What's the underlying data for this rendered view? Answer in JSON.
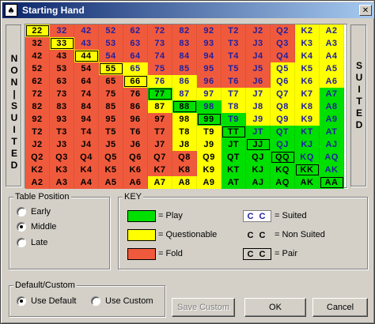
{
  "window": {
    "title": "Starting Hand",
    "icon": "playing-card-icon",
    "close_label": "✕"
  },
  "side_labels": {
    "left": [
      "N",
      "O",
      "N",
      "|",
      "S",
      "U",
      "I",
      "T",
      "E",
      "D"
    ],
    "right": [
      "S",
      "U",
      "I",
      "T",
      "E",
      "D"
    ]
  },
  "grid": {
    "rows": [
      [
        [
          "22",
          "yellow"
        ],
        [
          "32",
          "red"
        ],
        [
          "42",
          "red"
        ],
        [
          "52",
          "red"
        ],
        [
          "62",
          "red"
        ],
        [
          "72",
          "red"
        ],
        [
          "82",
          "red"
        ],
        [
          "92",
          "red"
        ],
        [
          "T2",
          "red"
        ],
        [
          "J2",
          "red"
        ],
        [
          "Q2",
          "red"
        ],
        [
          "K2",
          "yellow"
        ],
        [
          "A2",
          "yellow"
        ]
      ],
      [
        [
          "32",
          "red"
        ],
        [
          "33",
          "yellow"
        ],
        [
          "43",
          "red"
        ],
        [
          "53",
          "red"
        ],
        [
          "63",
          "red"
        ],
        [
          "73",
          "red"
        ],
        [
          "83",
          "red"
        ],
        [
          "93",
          "red"
        ],
        [
          "T3",
          "red"
        ],
        [
          "J3",
          "red"
        ],
        [
          "Q3",
          "red"
        ],
        [
          "K3",
          "yellow"
        ],
        [
          "A3",
          "yellow"
        ]
      ],
      [
        [
          "42",
          "red"
        ],
        [
          "43",
          "red"
        ],
        [
          "44",
          "yellow"
        ],
        [
          "54",
          "red"
        ],
        [
          "64",
          "red"
        ],
        [
          "74",
          "red"
        ],
        [
          "84",
          "red"
        ],
        [
          "94",
          "red"
        ],
        [
          "T4",
          "red"
        ],
        [
          "J4",
          "red"
        ],
        [
          "Q4",
          "red"
        ],
        [
          "K4",
          "yellow"
        ],
        [
          "A4",
          "yellow"
        ]
      ],
      [
        [
          "52",
          "red"
        ],
        [
          "53",
          "red"
        ],
        [
          "54",
          "red"
        ],
        [
          "55",
          "yellow"
        ],
        [
          "65",
          "yellow"
        ],
        [
          "75",
          "red"
        ],
        [
          "85",
          "red"
        ],
        [
          "95",
          "red"
        ],
        [
          "T5",
          "red"
        ],
        [
          "J5",
          "red"
        ],
        [
          "Q5",
          "yellow"
        ],
        [
          "K5",
          "yellow"
        ],
        [
          "A5",
          "yellow"
        ]
      ],
      [
        [
          "62",
          "red"
        ],
        [
          "63",
          "red"
        ],
        [
          "64",
          "red"
        ],
        [
          "65",
          "red"
        ],
        [
          "66",
          "yellow"
        ],
        [
          "76",
          "yellow"
        ],
        [
          "86",
          "yellow"
        ],
        [
          "96",
          "red"
        ],
        [
          "T6",
          "red"
        ],
        [
          "J6",
          "red"
        ],
        [
          "Q6",
          "yellow"
        ],
        [
          "K6",
          "yellow"
        ],
        [
          "A6",
          "yellow"
        ]
      ],
      [
        [
          "72",
          "red"
        ],
        [
          "73",
          "red"
        ],
        [
          "74",
          "red"
        ],
        [
          "75",
          "red"
        ],
        [
          "76",
          "red"
        ],
        [
          "77",
          "green"
        ],
        [
          "87",
          "yellow"
        ],
        [
          "97",
          "yellow"
        ],
        [
          "T7",
          "yellow"
        ],
        [
          "J7",
          "yellow"
        ],
        [
          "Q7",
          "yellow"
        ],
        [
          "K7",
          "yellow"
        ],
        [
          "A7",
          "green"
        ]
      ],
      [
        [
          "82",
          "red"
        ],
        [
          "83",
          "red"
        ],
        [
          "84",
          "red"
        ],
        [
          "85",
          "red"
        ],
        [
          "86",
          "red"
        ],
        [
          "87",
          "yellow"
        ],
        [
          "88",
          "green"
        ],
        [
          "98",
          "green"
        ],
        [
          "T8",
          "yellow"
        ],
        [
          "J8",
          "yellow"
        ],
        [
          "Q8",
          "yellow"
        ],
        [
          "K8",
          "yellow"
        ],
        [
          "A8",
          "green"
        ]
      ],
      [
        [
          "92",
          "red"
        ],
        [
          "93",
          "red"
        ],
        [
          "94",
          "red"
        ],
        [
          "95",
          "red"
        ],
        [
          "96",
          "red"
        ],
        [
          "97",
          "red"
        ],
        [
          "98",
          "yellow"
        ],
        [
          "99",
          "green"
        ],
        [
          "T9",
          "green"
        ],
        [
          "J9",
          "yellow"
        ],
        [
          "Q9",
          "yellow"
        ],
        [
          "K9",
          "yellow"
        ],
        [
          "A9",
          "green"
        ]
      ],
      [
        [
          "T2",
          "red"
        ],
        [
          "T3",
          "red"
        ],
        [
          "T4",
          "red"
        ],
        [
          "T5",
          "red"
        ],
        [
          "T6",
          "red"
        ],
        [
          "T7",
          "red"
        ],
        [
          "T8",
          "yellow"
        ],
        [
          "T9",
          "yellow"
        ],
        [
          "TT",
          "green"
        ],
        [
          "JT",
          "green"
        ],
        [
          "QT",
          "green"
        ],
        [
          "KT",
          "green"
        ],
        [
          "AT",
          "green"
        ]
      ],
      [
        [
          "J2",
          "red"
        ],
        [
          "J3",
          "red"
        ],
        [
          "J4",
          "red"
        ],
        [
          "J5",
          "red"
        ],
        [
          "J6",
          "red"
        ],
        [
          "J7",
          "red"
        ],
        [
          "J8",
          "yellow"
        ],
        [
          "J9",
          "yellow"
        ],
        [
          "JT",
          "green"
        ],
        [
          "JJ",
          "green"
        ],
        [
          "QJ",
          "green"
        ],
        [
          "KJ",
          "green"
        ],
        [
          "AJ",
          "green"
        ]
      ],
      [
        [
          "Q2",
          "red"
        ],
        [
          "Q3",
          "red"
        ],
        [
          "Q4",
          "red"
        ],
        [
          "Q5",
          "red"
        ],
        [
          "Q6",
          "red"
        ],
        [
          "Q7",
          "red"
        ],
        [
          "Q8",
          "red"
        ],
        [
          "Q9",
          "yellow"
        ],
        [
          "QT",
          "green"
        ],
        [
          "QJ",
          "green"
        ],
        [
          "QQ",
          "green"
        ],
        [
          "KQ",
          "green"
        ],
        [
          "AQ",
          "green"
        ]
      ],
      [
        [
          "K2",
          "red"
        ],
        [
          "K3",
          "red"
        ],
        [
          "K4",
          "red"
        ],
        [
          "K5",
          "red"
        ],
        [
          "K6",
          "red"
        ],
        [
          "K7",
          "red"
        ],
        [
          "K8",
          "red"
        ],
        [
          "K9",
          "yellow"
        ],
        [
          "KT",
          "green"
        ],
        [
          "KJ",
          "green"
        ],
        [
          "KQ",
          "green"
        ],
        [
          "KK",
          "green"
        ],
        [
          "AK",
          "green"
        ]
      ],
      [
        [
          "A2",
          "red"
        ],
        [
          "A3",
          "red"
        ],
        [
          "A4",
          "red"
        ],
        [
          "A5",
          "red"
        ],
        [
          "A6",
          "red"
        ],
        [
          "A7",
          "yellow"
        ],
        [
          "A8",
          "yellow"
        ],
        [
          "A9",
          "yellow"
        ],
        [
          "AT",
          "green"
        ],
        [
          "AJ",
          "green"
        ],
        [
          "AQ",
          "green"
        ],
        [
          "AK",
          "green"
        ],
        [
          "AA",
          "green"
        ]
      ]
    ]
  },
  "colors": {
    "play": "#00e000",
    "questionable": "#ffff00",
    "fold": "#f05a3c",
    "suited_text": "#2020a0",
    "titlebar": "#0a246a"
  },
  "table_position": {
    "title": "Table Position",
    "options": [
      "Early",
      "Middle",
      "Late"
    ],
    "selected": "Middle"
  },
  "key": {
    "title": "KEY",
    "play": "= Play",
    "questionable": "= Questionable",
    "fold": "= Fold",
    "cc": "C C",
    "suited": "= Suited",
    "non_suited": "= Non Suited",
    "pair": "= Pair"
  },
  "default_custom": {
    "title": "Default/Custom",
    "options": [
      "Use Default",
      "Use Custom"
    ],
    "selected": "Use Default"
  },
  "buttons": {
    "save_custom": "Save Custom",
    "ok": "OK",
    "cancel": "Cancel"
  }
}
